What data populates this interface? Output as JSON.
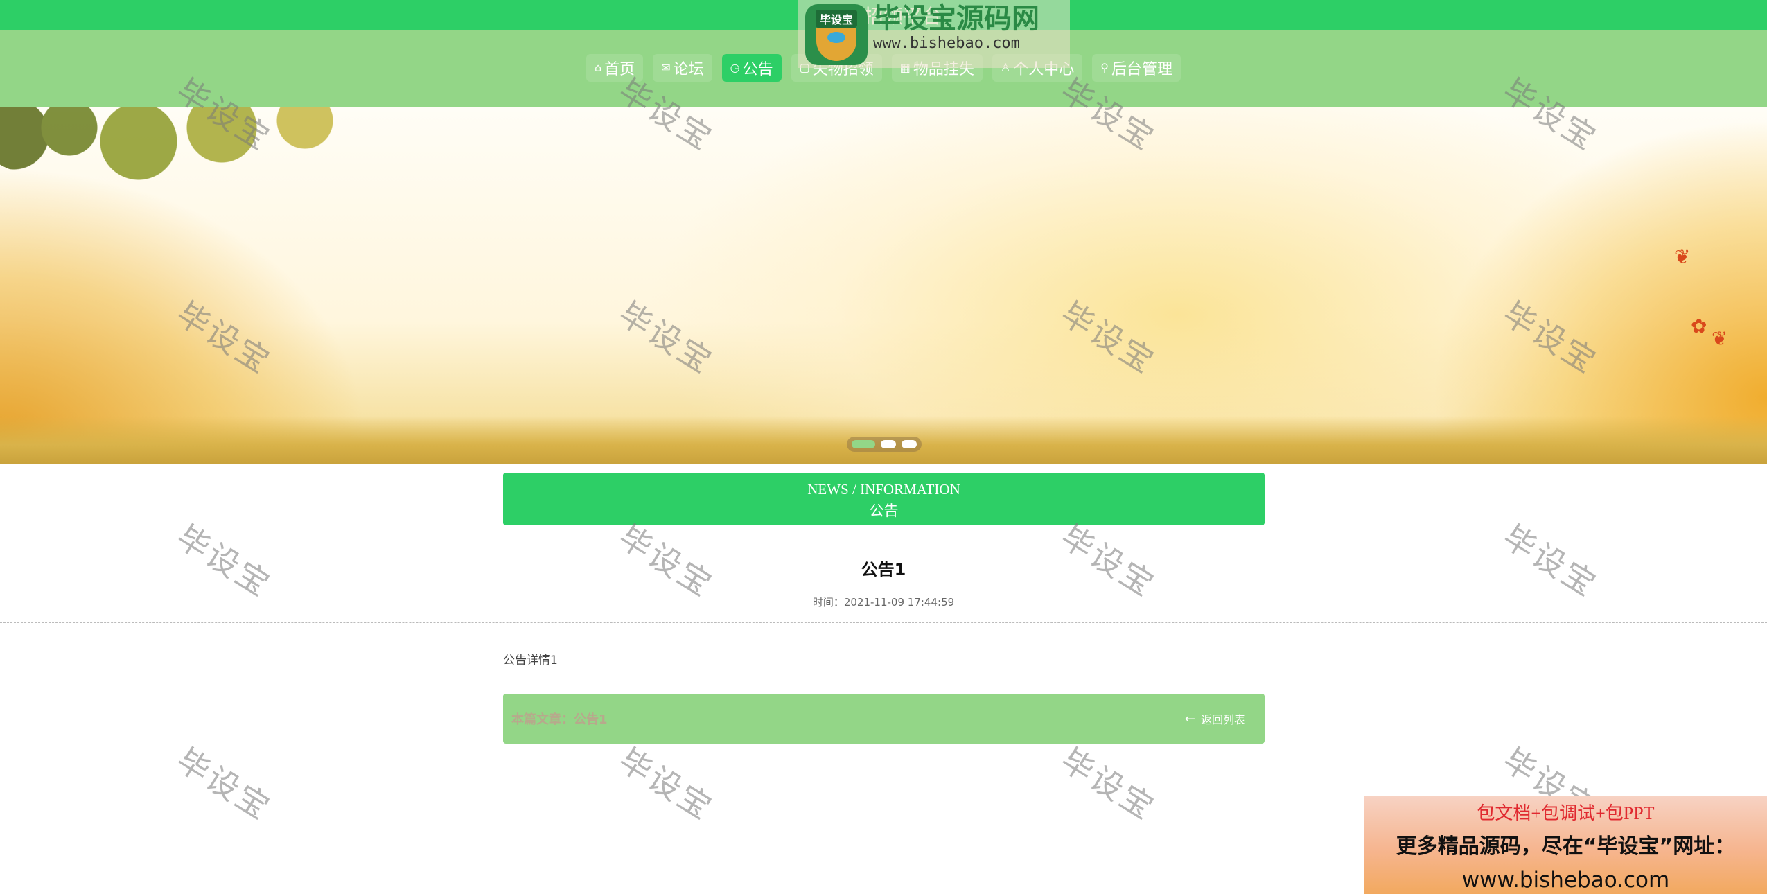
{
  "site": {
    "title": "失物招领平台"
  },
  "nav": {
    "items": [
      {
        "label": "首页",
        "icon": "home-icon",
        "glyph": "⌂",
        "active": false
      },
      {
        "label": "论坛",
        "icon": "mail-icon",
        "glyph": "✉",
        "active": false
      },
      {
        "label": "公告",
        "icon": "clock-icon",
        "glyph": "◷",
        "active": true
      },
      {
        "label": "失物招领",
        "icon": "tag-icon",
        "glyph": "▢",
        "active": false
      },
      {
        "label": "物品挂失",
        "icon": "grid-icon",
        "glyph": "▦",
        "active": false
      },
      {
        "label": "个人中心",
        "icon": "user-icon",
        "glyph": "♙",
        "active": false
      },
      {
        "label": "后台管理",
        "icon": "link-icon",
        "glyph": "⚲",
        "active": false
      }
    ]
  },
  "banner": {
    "slide_count": 3,
    "active_slide": 1
  },
  "news_header": {
    "en": "NEWS / INFORMATION",
    "cn": "公告"
  },
  "article": {
    "title": "公告1",
    "time": "时间：2021-11-09 17:44:59",
    "body": "公告详情1"
  },
  "footer_bar": {
    "this_article": "本篇文章：公告1",
    "back_label": "返回列表"
  },
  "watermark": {
    "text": "毕设宝"
  },
  "logo_overlay": {
    "badge": "毕设宝",
    "name": "毕设宝源码网",
    "url": "www.bishebao.com"
  },
  "ad": {
    "line1": "包文档+包调试+包PPT",
    "line2": "更多精品源码，尽在“毕设宝”网址：",
    "line3": "www.bishebao.com"
  },
  "colors": {
    "primary": "#2dcf66",
    "nav_bg": "#93d687",
    "footer_bg": "#93d687",
    "ad_red": "#e0292f"
  }
}
